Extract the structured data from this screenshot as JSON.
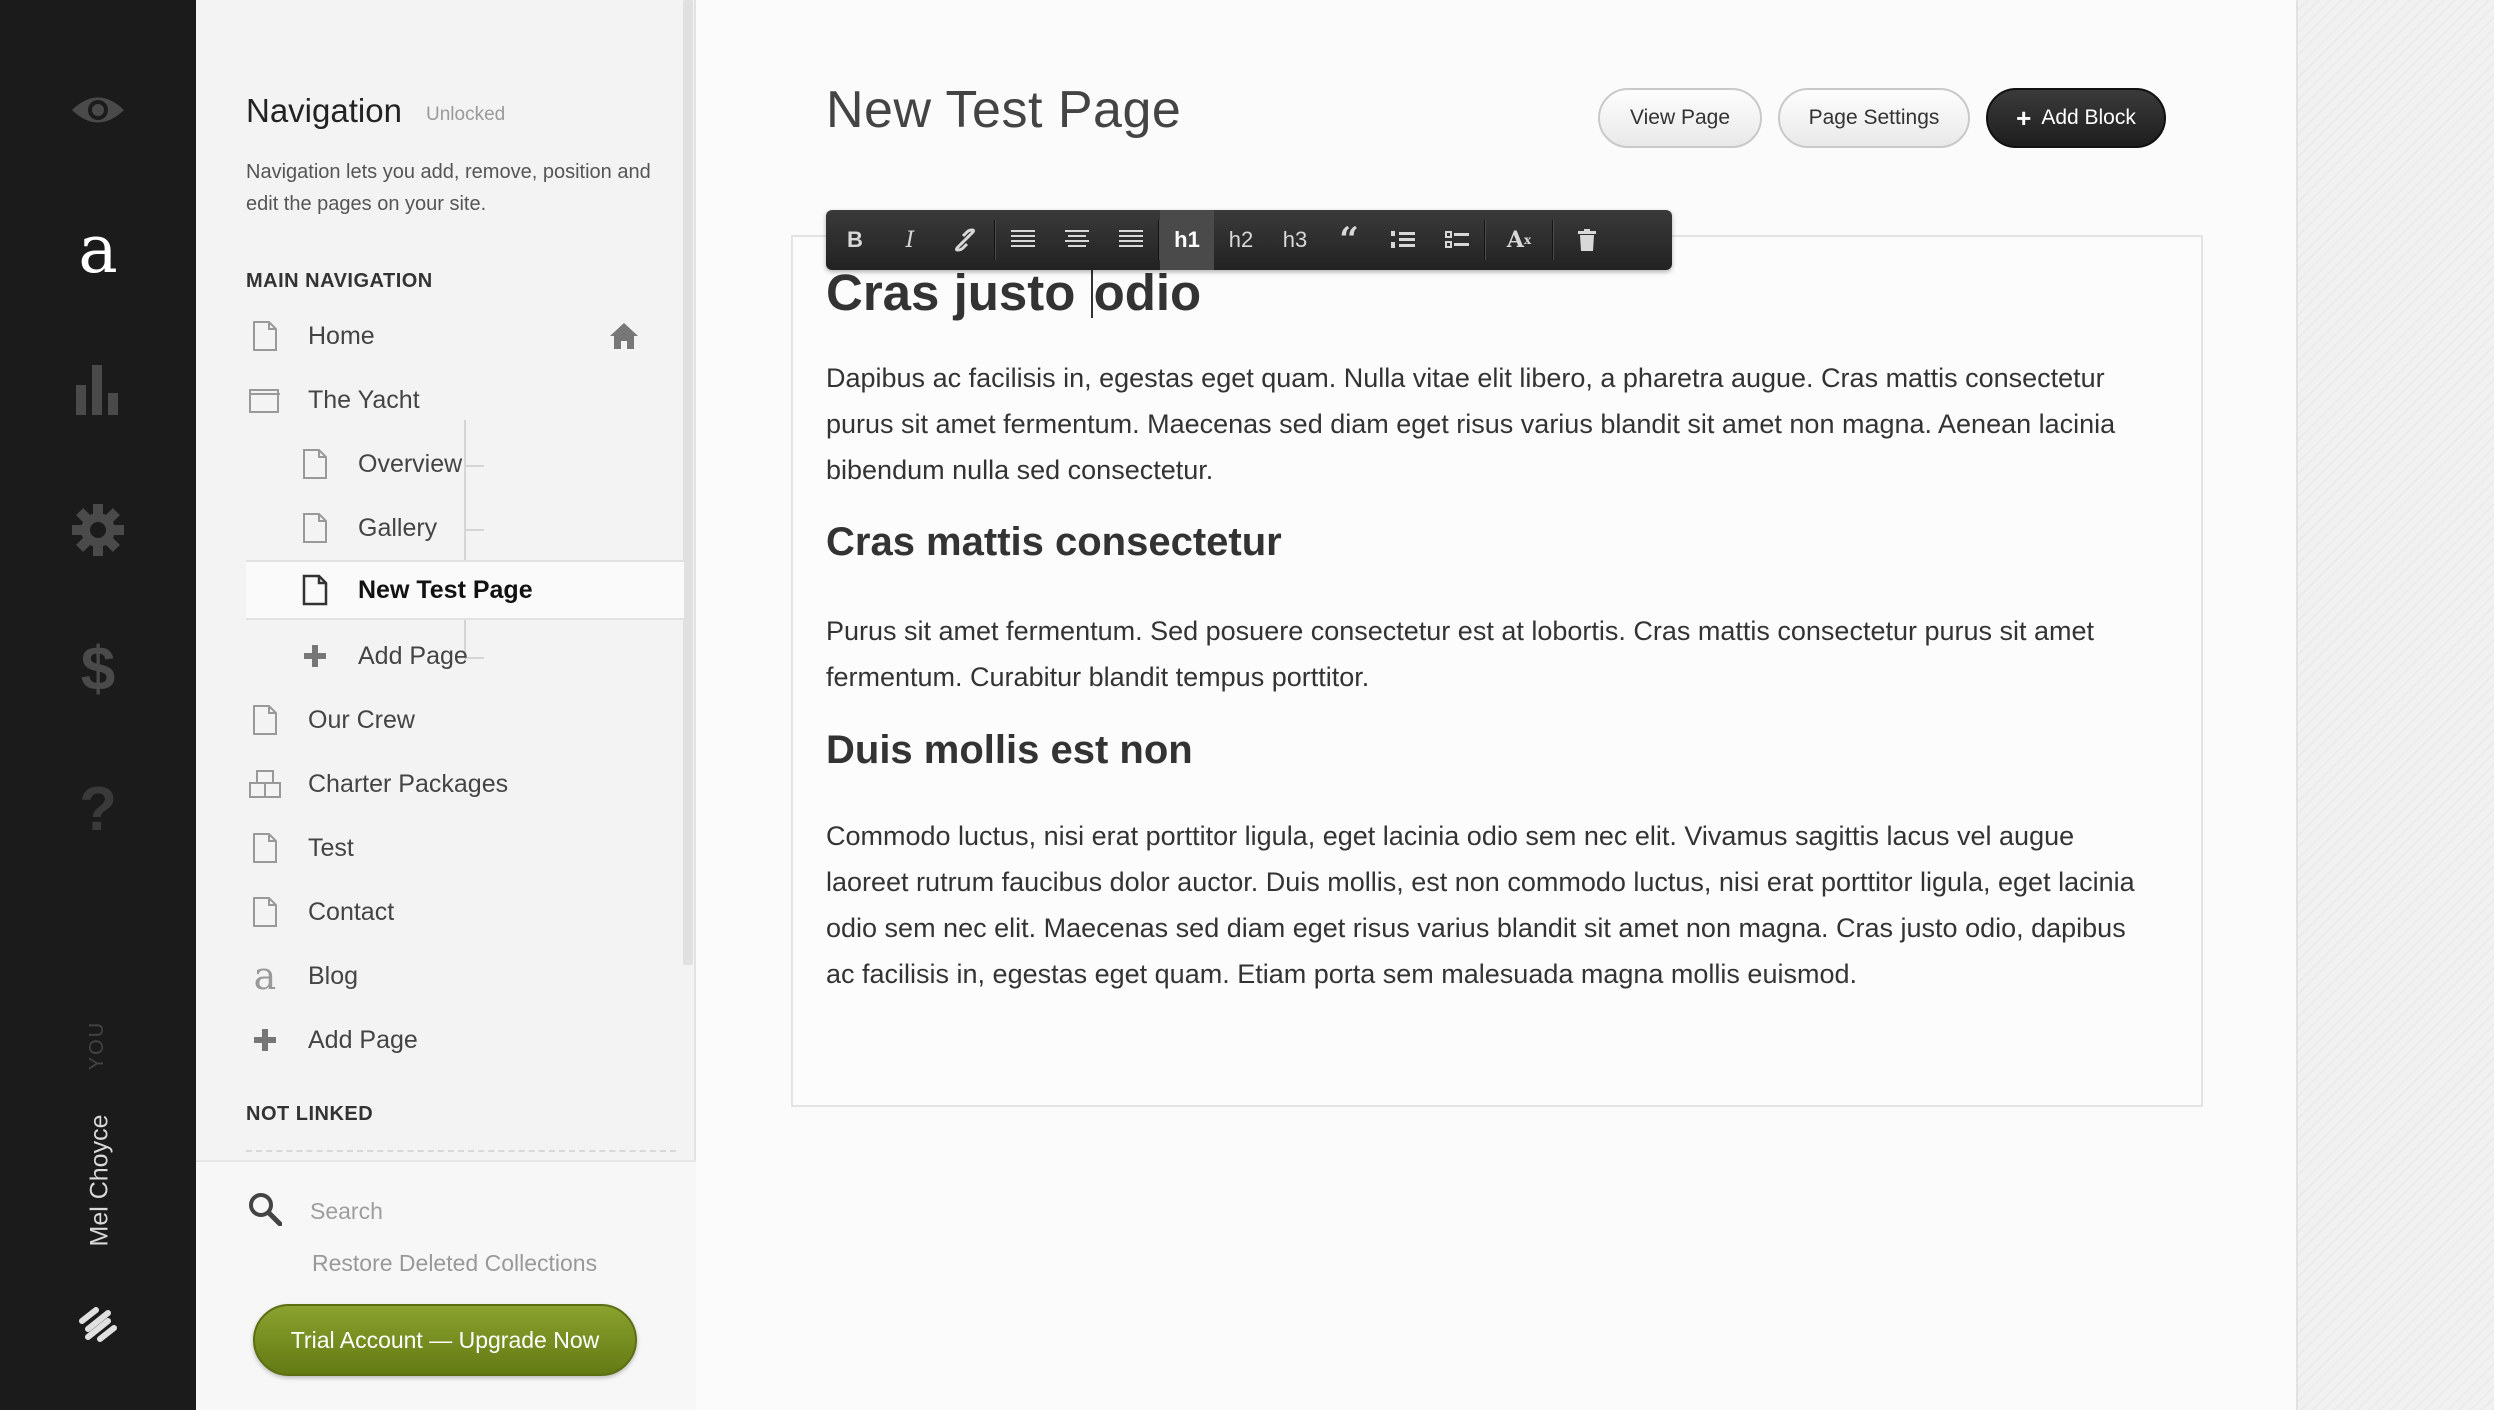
{
  "rail": {
    "icons": [
      "eye-icon",
      "logo-a-icon",
      "chart-icon",
      "gear-icon",
      "dollar-icon",
      "help-icon",
      "squarespace-logo-icon"
    ],
    "you_label": "YOU",
    "user_name": "Mel Choyce"
  },
  "nav": {
    "title": "Navigation",
    "status": "Unlocked",
    "description": "Navigation lets you add, remove, position and edit the pages on your site.",
    "main_label": "MAIN NAVIGATION",
    "items": [
      {
        "label": "Home",
        "icon": "page-icon"
      },
      {
        "label": "The Yacht",
        "icon": "folder-icon"
      },
      {
        "label": "Overview",
        "icon": "page-icon"
      },
      {
        "label": "Gallery",
        "icon": "page-icon"
      },
      {
        "label": "New Test Page",
        "icon": "page-icon"
      },
      {
        "label": "Add Page",
        "icon": "plus-icon"
      },
      {
        "label": "Our Crew",
        "icon": "page-icon"
      },
      {
        "label": "Charter Packages",
        "icon": "products-icon"
      },
      {
        "label": "Test",
        "icon": "page-icon"
      },
      {
        "label": "Contact",
        "icon": "page-icon"
      },
      {
        "label": "Blog",
        "icon": "blog-icon"
      },
      {
        "label": "Add Page",
        "icon": "plus-icon"
      }
    ],
    "not_linked_label": "NOT LINKED",
    "search_placeholder": "Search",
    "restore_label": "Restore Deleted Collections",
    "upgrade_label": "Trial Account — Upgrade Now"
  },
  "page": {
    "title": "New Test Page",
    "view_label": "View Page",
    "settings_label": "Page Settings",
    "add_block_label": "Add Block",
    "toolbar": [
      "B",
      "I",
      "link",
      "align-left",
      "align-center",
      "align-right",
      "h1",
      "h2",
      "h3",
      "quote",
      "ordered-list",
      "unordered-list",
      "clear-format",
      "delete"
    ],
    "heading1_a": "Cras justo ",
    "heading1_b": "odio",
    "para1": "Dapibus ac facilisis in, egestas eget quam. Nulla vitae elit libero, a pharetra augue. Cras mattis consectetur purus sit amet fermentum. Maecenas sed diam eget risus varius blandit sit amet non magna. Aenean lacinia bibendum nulla sed consectetur.",
    "heading2": "Cras mattis consectetur",
    "para2": "Purus sit amet fermentum. Sed posuere consectetur est at lobortis. Cras mattis consectetur purus sit amet fermentum. Curabitur blandit tempus porttitor.",
    "heading3": "Duis mollis est non",
    "para3": "Commodo luctus, nisi erat porttitor ligula, eget lacinia odio sem nec elit. Vivamus sagittis lacus vel augue laoreet rutrum faucibus dolor auctor. Duis mollis, est non commodo luctus, nisi erat porttitor ligula, eget lacinia odio sem nec elit. Maecenas sed diam eget risus varius blandit sit amet non magna. Cras justo odio, dapibus ac facilisis in, egestas eget quam. Etiam porta sem malesuada magna mollis euismod."
  }
}
